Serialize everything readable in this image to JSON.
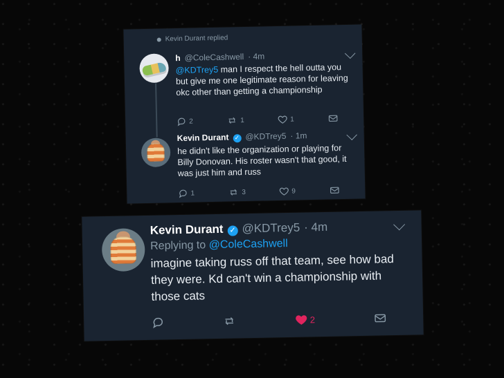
{
  "screens": {
    "top_card": {
      "replied_label": "Kevin Durant replied",
      "tweets": [
        {
          "name": "h",
          "handle": "@ColeCashwell",
          "time": "4m",
          "mention": "@KDTrey5",
          "text": " man I respect the hell outta you but give me one legitimate reason for leaving okc other than getting a championship",
          "actions": {
            "reply": "2",
            "retweet": "1",
            "like": "1",
            "dm": ""
          }
        },
        {
          "name": "Kevin Durant",
          "verified": true,
          "handle": "@KDTrey5",
          "time": "1m",
          "text": "he didn't like the organization or playing for Billy Donovan. His roster wasn't that good, it was just him and russ",
          "actions": {
            "reply": "1",
            "retweet": "3",
            "like": "9",
            "dm": ""
          }
        }
      ]
    },
    "bottom_card": {
      "name": "Kevin Durant",
      "verified": true,
      "handle": "@KDTrey5",
      "time": "4m",
      "replying_label": "Replying to",
      "replying_to": "@ColeCashwell",
      "text": "imagine taking russ off that team, see how bad they were. Kd can't win a championship with those cats",
      "actions": {
        "reply": "",
        "retweet": "",
        "like": "2",
        "dm": ""
      }
    }
  },
  "icons": {
    "reply": "reply-icon",
    "retweet": "retweet-icon",
    "like": "heart-icon",
    "dm": "message-icon",
    "more": "chevron-down-icon",
    "verified": "verified-badge-icon"
  },
  "colors": {
    "background": "#070707",
    "card": "#1a2431",
    "text": "#e8edf2",
    "muted": "#8899a6",
    "accent": "#1da1f2",
    "like": "#e0245e"
  }
}
